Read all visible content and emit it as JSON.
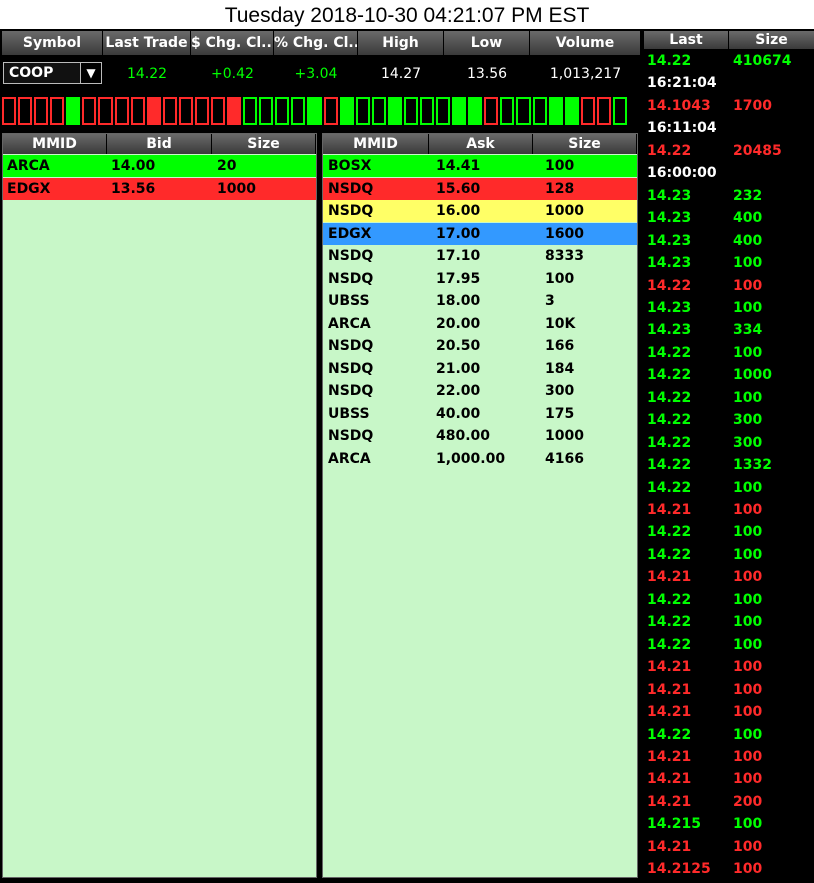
{
  "title": "Tuesday 2018-10-30 04:21:07 PM EST",
  "quote": {
    "headers": [
      "Symbol",
      "Last Trade",
      "$ Chg. Cl...",
      "% Chg. Cl...",
      "High",
      "Low",
      "Volume"
    ],
    "symbol": "COOP",
    "last_trade": "14.22",
    "chg_dollar": "+0.42",
    "chg_pct": "+3.04",
    "high": "14.27",
    "low": "13.56",
    "volume": "1,013,217"
  },
  "tick_colors": [
    "red",
    "red",
    "red",
    "red",
    "green",
    "red",
    "red",
    "red",
    "red",
    "red",
    "red",
    "red",
    "red",
    "red",
    "red",
    "green",
    "green",
    "green",
    "green",
    "green",
    "red",
    "green",
    "green",
    "green",
    "green",
    "green",
    "green",
    "green",
    "green",
    "green",
    "red",
    "green",
    "green",
    "green",
    "green",
    "green",
    "red",
    "red",
    "green"
  ],
  "colors": {
    "green": "#00ff00",
    "red": "#ff2a2a",
    "yellow": "#ffff66",
    "blue": "#3399ff",
    "panel": "#c8f7c8"
  },
  "bid": {
    "headers": [
      "MMID",
      "Bid",
      "Size"
    ],
    "rows": [
      {
        "mmid": "ARCA",
        "price": "14.00",
        "size": "20",
        "color": "green"
      },
      {
        "mmid": "EDGX",
        "price": "13.56",
        "size": "1000",
        "color": "red"
      }
    ]
  },
  "ask": {
    "headers": [
      "MMID",
      "Ask",
      "Size"
    ],
    "rows": [
      {
        "mmid": "BOSX",
        "price": "14.41",
        "size": "100",
        "color": "green"
      },
      {
        "mmid": "NSDQ",
        "price": "15.60",
        "size": "128",
        "color": "red"
      },
      {
        "mmid": "NSDQ",
        "price": "16.00",
        "size": "1000",
        "color": "yellow"
      },
      {
        "mmid": "EDGX",
        "price": "17.00",
        "size": "1600",
        "color": "blue"
      },
      {
        "mmid": "NSDQ",
        "price": "17.10",
        "size": "8333",
        "color": ""
      },
      {
        "mmid": "NSDQ",
        "price": "17.95",
        "size": "100",
        "color": ""
      },
      {
        "mmid": "UBSS",
        "price": "18.00",
        "size": "3",
        "color": ""
      },
      {
        "mmid": "ARCA",
        "price": "20.00",
        "size": "10K",
        "color": ""
      },
      {
        "mmid": "NSDQ",
        "price": "20.50",
        "size": "166",
        "color": ""
      },
      {
        "mmid": "NSDQ",
        "price": "21.00",
        "size": "184",
        "color": ""
      },
      {
        "mmid": "NSDQ",
        "price": "22.00",
        "size": "300",
        "color": ""
      },
      {
        "mmid": "UBSS",
        "price": "40.00",
        "size": "175",
        "color": ""
      },
      {
        "mmid": "NSDQ",
        "price": "480.00",
        "size": "1000",
        "color": ""
      },
      {
        "mmid": "ARCA",
        "price": "1,000.00",
        "size": "4166",
        "color": ""
      }
    ]
  },
  "time_sales": {
    "headers": [
      "Last",
      "Size"
    ],
    "rows": [
      {
        "last": "14.22",
        "size": "410674",
        "color": "green"
      },
      {
        "last": "16:21:04",
        "size": "",
        "color": "white"
      },
      {
        "last": "14.1043",
        "size": "1700",
        "color": "red"
      },
      {
        "last": "16:11:04",
        "size": "",
        "color": "white"
      },
      {
        "last": "14.22",
        "size": "20485",
        "color": "red"
      },
      {
        "last": "16:00:00",
        "size": "",
        "color": "white"
      },
      {
        "last": "14.23",
        "size": "232",
        "color": "green"
      },
      {
        "last": "14.23",
        "size": "400",
        "color": "green"
      },
      {
        "last": "14.23",
        "size": "400",
        "color": "green"
      },
      {
        "last": "14.23",
        "size": "100",
        "color": "green"
      },
      {
        "last": "14.22",
        "size": "100",
        "color": "red"
      },
      {
        "last": "14.23",
        "size": "100",
        "color": "green"
      },
      {
        "last": "14.23",
        "size": "334",
        "color": "green"
      },
      {
        "last": "14.22",
        "size": "100",
        "color": "green"
      },
      {
        "last": "14.22",
        "size": "1000",
        "color": "green"
      },
      {
        "last": "14.22",
        "size": "100",
        "color": "green"
      },
      {
        "last": "14.22",
        "size": "300",
        "color": "green"
      },
      {
        "last": "14.22",
        "size": "300",
        "color": "green"
      },
      {
        "last": "14.22",
        "size": "1332",
        "color": "green"
      },
      {
        "last": "14.22",
        "size": "100",
        "color": "green"
      },
      {
        "last": "14.21",
        "size": "100",
        "color": "red"
      },
      {
        "last": "14.22",
        "size": "100",
        "color": "green"
      },
      {
        "last": "14.22",
        "size": "100",
        "color": "green"
      },
      {
        "last": "14.21",
        "size": "100",
        "color": "red"
      },
      {
        "last": "14.22",
        "size": "100",
        "color": "green"
      },
      {
        "last": "14.22",
        "size": "100",
        "color": "green"
      },
      {
        "last": "14.22",
        "size": "100",
        "color": "green"
      },
      {
        "last": "14.21",
        "size": "100",
        "color": "red"
      },
      {
        "last": "14.21",
        "size": "100",
        "color": "red"
      },
      {
        "last": "14.21",
        "size": "100",
        "color": "red"
      },
      {
        "last": "14.22",
        "size": "100",
        "color": "green"
      },
      {
        "last": "14.21",
        "size": "100",
        "color": "red"
      },
      {
        "last": "14.21",
        "size": "100",
        "color": "red"
      },
      {
        "last": "14.21",
        "size": "200",
        "color": "red"
      },
      {
        "last": "14.215",
        "size": "100",
        "color": "green"
      },
      {
        "last": "14.21",
        "size": "100",
        "color": "red"
      },
      {
        "last": "14.2125",
        "size": "100",
        "color": "red"
      }
    ]
  }
}
